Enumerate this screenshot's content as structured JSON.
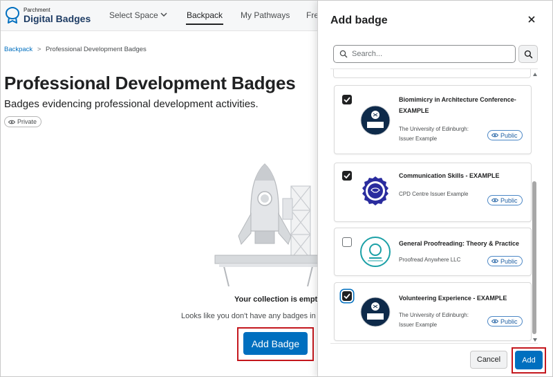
{
  "brand": {
    "small": "Parchment",
    "big": "Digital Badges"
  },
  "nav": {
    "select_space": "Select Space",
    "backpack": "Backpack",
    "my_pathways": "My Pathways",
    "cut": "Fre"
  },
  "breadcrumb": {
    "root": "Backpack",
    "separator": ">",
    "current": "Professional Development Badges"
  },
  "page": {
    "title": "Professional Development Badges",
    "subtitle": "Badges evidencing professional development activities.",
    "visibility": "Private"
  },
  "empty_state": {
    "title": "Your collection is empty",
    "description": "Looks like you don't have any badges in h",
    "add_button": "Add Badge"
  },
  "dialog": {
    "title": "Add badge",
    "search_placeholder": "Search...",
    "cancel": "Cancel",
    "add": "Add",
    "badges": [
      {
        "name": "Biomimicry in Architecture Conference-EXAMPLE",
        "issuer": "The University of Edinburgh: Issuer Example",
        "visibility": "Public",
        "checked": true
      },
      {
        "name": "Communication Skills - EXAMPLE",
        "issuer": "CPD Centre Issuer Example",
        "visibility": "Public",
        "checked": true
      },
      {
        "name": "General Proofreading: Theory & Practice",
        "issuer": "Proofread Anywhere LLC",
        "visibility": "Public",
        "checked": false
      },
      {
        "name": "Volunteering Experience - EXAMPLE",
        "issuer": "The University of Edinburgh: Issuer Example",
        "visibility": "Public",
        "checked": true
      }
    ]
  },
  "colors": {
    "primary": "#006fbf",
    "highlight": "#c4171d",
    "text": "#202122"
  }
}
